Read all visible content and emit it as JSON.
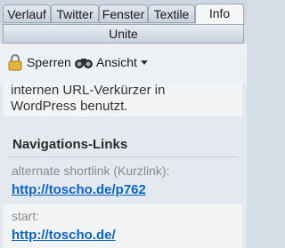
{
  "tabs": [
    {
      "label": "Verlauf"
    },
    {
      "label": "Twitter"
    },
    {
      "label": "Fenster"
    },
    {
      "label": "Textile"
    },
    {
      "label": "Info"
    }
  ],
  "subtab": {
    "label": "Unite"
  },
  "toolbar": {
    "lock_label": "Sperren",
    "view_label": "Ansicht"
  },
  "content": {
    "intro_text_line1": "internen URL-Verkürzer in",
    "intro_text_line2": "WordPress benutzt.",
    "section_title": "Navigations-Links",
    "links": [
      {
        "label": "alternate shortlink (Kurzlink):",
        "url": "http://toscho.de/p762"
      },
      {
        "label": "start:",
        "url": "http://toscho.de/"
      }
    ]
  }
}
